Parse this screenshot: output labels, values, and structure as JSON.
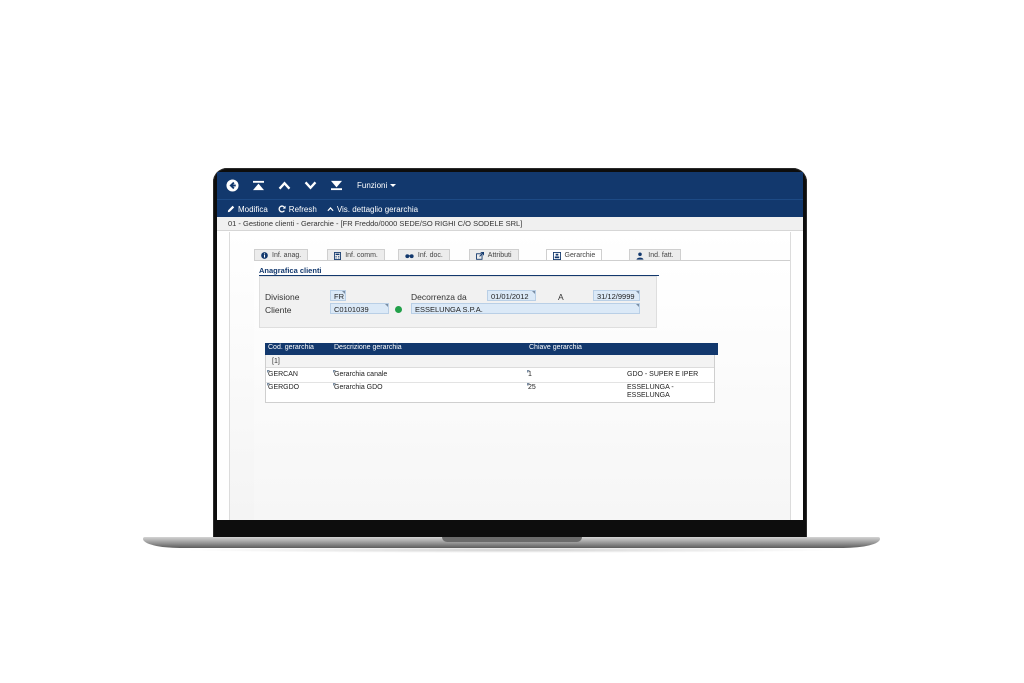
{
  "nav": {
    "funzioni_label": "Funzioni"
  },
  "toolbar": {
    "modifica": "Modifica",
    "refresh": "Refresh",
    "vis_dettaglio": "Vis. dettaglio gerarchia"
  },
  "breadcrumb": "01 - Gestione clienti - Gerarchie - [FR Freddo/0000 SEDE/SO RIGHI C/O SODELE SRL]",
  "tabs": [
    {
      "label": "Inf. anag.",
      "icon": "info-icon"
    },
    {
      "label": "Inf. comm.",
      "icon": "calculator-icon"
    },
    {
      "label": "Inf. doc.",
      "icon": "binoculars-icon"
    },
    {
      "label": "Attributi",
      "icon": "external-link-icon"
    },
    {
      "label": "Gerarchie",
      "icon": "hierarchy-icon",
      "active": true
    },
    {
      "label": "Ind. fatt.",
      "icon": "user-icon"
    }
  ],
  "anagrafica": {
    "title": "Anagrafica clienti",
    "divisione_label": "Divisione",
    "divisione_value": "FR",
    "decorrenza_label": "Decorrenza da",
    "decorrenza_value": "01/01/2012",
    "a_label": "A",
    "a_value": "31/12/9999",
    "cliente_label": "Cliente",
    "cliente_code": "C0101039",
    "cliente_name": "ESSELUNGA S.P.A."
  },
  "grid": {
    "headers": [
      "Cod. gerarchia",
      "Descrizione gerarchia",
      "Chiave gerarchia"
    ],
    "group": "[1]",
    "rows": [
      {
        "cod": "GERCAN",
        "desc": "Gerarchia canale",
        "chiave": "1",
        "chiave_desc_1": "GDO - SUPER E IPER",
        "chiave_desc_2": ""
      },
      {
        "cod": "GERGDO",
        "desc": "Gerarchia GDO",
        "chiave": "25",
        "chiave_desc_1": "ESSELUNGA -",
        "chiave_desc_2": "ESSELUNGA"
      }
    ]
  },
  "colors": {
    "brand_navy": "#12386d",
    "field_blue": "#dbe9f7",
    "status_green": "#22a04a"
  }
}
